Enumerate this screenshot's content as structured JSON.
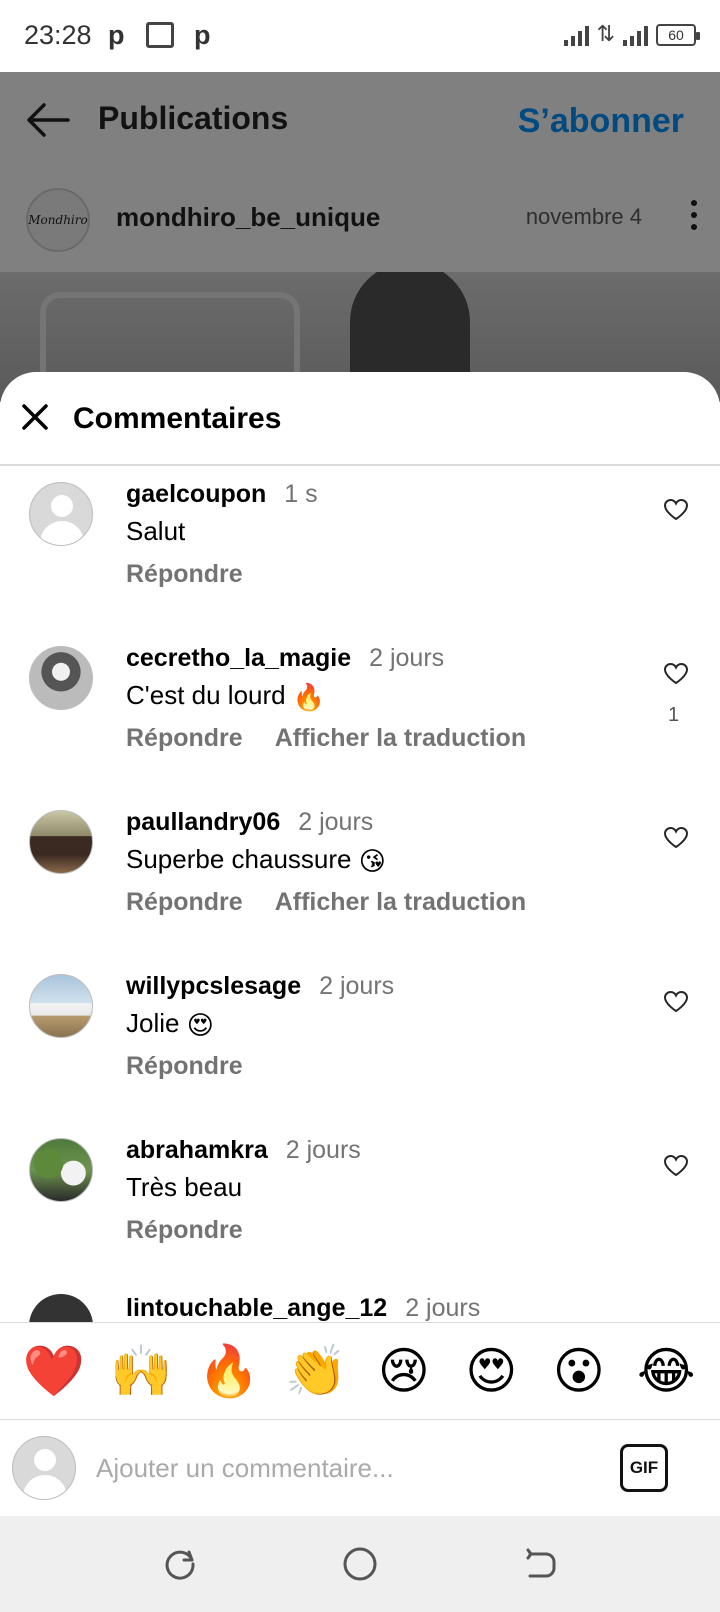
{
  "status_bar": {
    "time": "23:28",
    "app_icons": [
      "p",
      "p"
    ],
    "battery": "60"
  },
  "header": {
    "title": "Publications",
    "follow_label": "S’abonner",
    "follow_color": "#004a80"
  },
  "post": {
    "username": "mondhiro_be_unique",
    "date": "novembre 4",
    "avatar_logo_text": "Mondhiro"
  },
  "sheet": {
    "title": "Commentaires"
  },
  "comments": [
    {
      "username": "gaelcoupon",
      "time": "1 s",
      "text": "Salut",
      "emoji": "",
      "reply": "Répondre",
      "translate": "",
      "likes": ""
    },
    {
      "username": "cecretho_la_magie",
      "time": "2 jours",
      "text": "C'est du lourd",
      "emoji": "🔥",
      "reply": "Répondre",
      "translate": "Afficher la traduction",
      "likes": "1"
    },
    {
      "username": "paullandry06",
      "time": "2 jours",
      "text": "Superbe chaussure",
      "emoji": "😘",
      "reply": "Répondre",
      "translate": "Afficher la traduction",
      "likes": ""
    },
    {
      "username": "willypcslesage",
      "time": "2 jours",
      "text": "Jolie",
      "emoji": "😍",
      "reply": "Répondre",
      "translate": "",
      "likes": ""
    },
    {
      "username": "abrahamkra",
      "time": "2 jours",
      "text": "Très beau",
      "emoji": "",
      "reply": "Répondre",
      "translate": "",
      "likes": ""
    }
  ],
  "partial_comment": {
    "username": "lintouchable_ange_12",
    "time": "2 jours"
  },
  "reactions": [
    "❤️",
    "🙌",
    "🔥",
    "👏",
    "😢",
    "😍",
    "😮",
    "😂"
  ],
  "composer": {
    "placeholder": "Ajouter un commentaire...",
    "gif_label": "GIF"
  },
  "icons": {
    "back": "arrow-left-icon",
    "close": "close-icon",
    "heart": "heart-outline-icon",
    "more": "more-vertical-icon"
  }
}
